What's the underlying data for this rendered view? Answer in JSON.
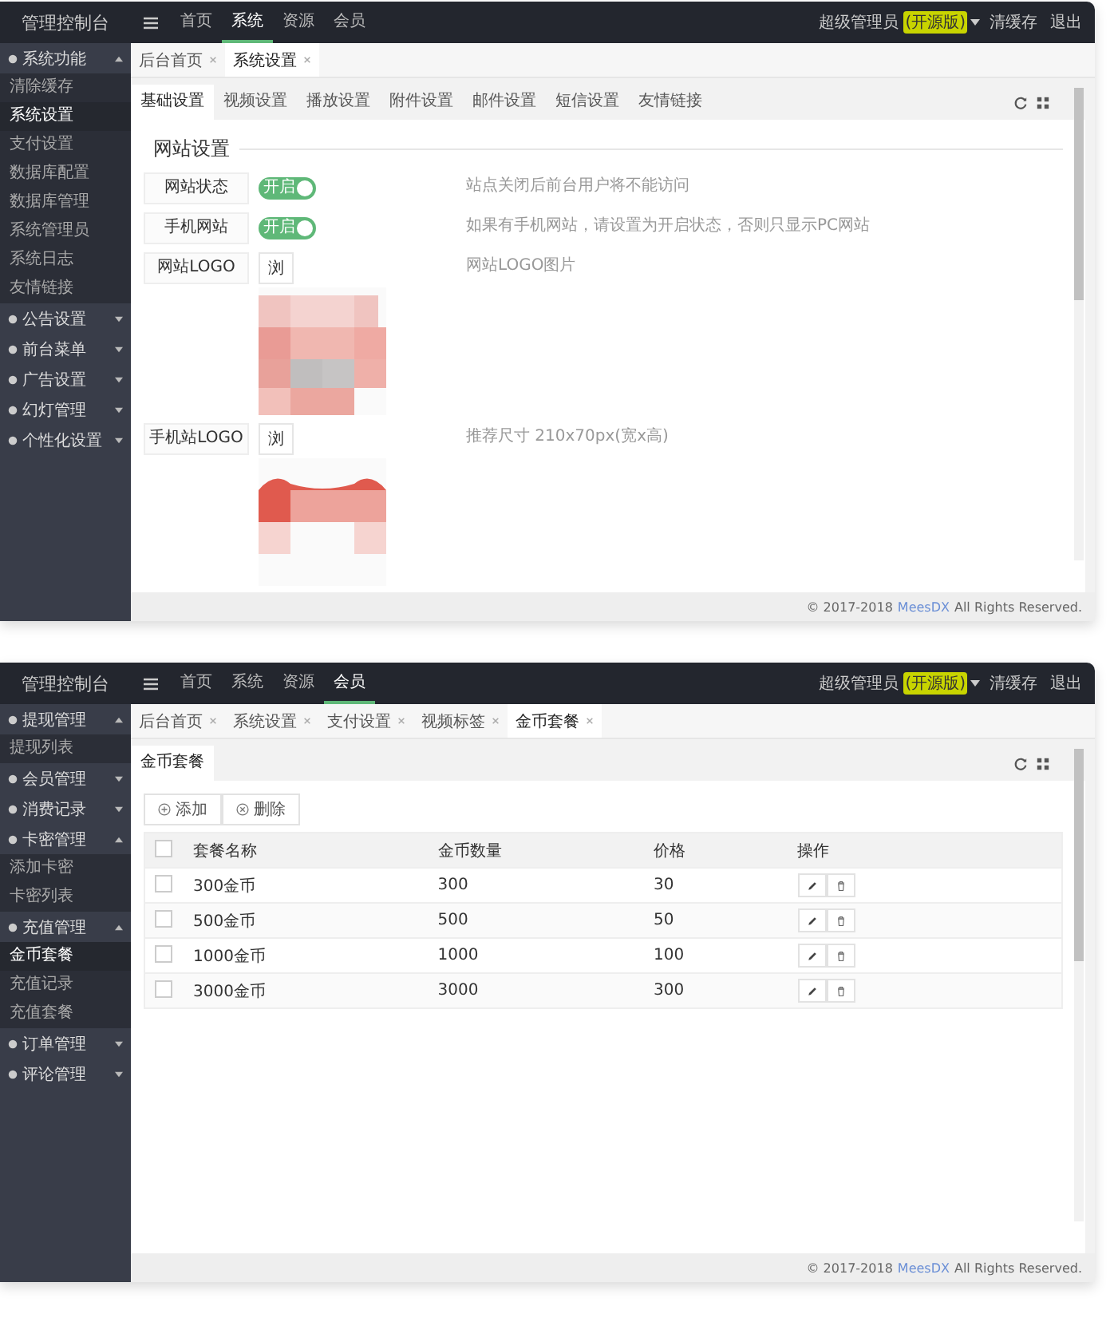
{
  "screens": [
    {
      "kind": "settings",
      "logo": "管理控制台",
      "nav": [
        {
          "label": "首页",
          "selected": false
        },
        {
          "label": "系统",
          "selected": true
        },
        {
          "label": "资源",
          "selected": false
        },
        {
          "label": "会员",
          "selected": false
        }
      ],
      "user": {
        "name": "超级管理员",
        "badge": "(开源版)",
        "links": [
          "清缓存",
          "退出"
        ]
      },
      "sidebar": [
        {
          "label": "系统功能",
          "expanded": true,
          "children": [
            {
              "label": "清除缓存",
              "selected": false
            },
            {
              "label": "系统设置",
              "selected": true
            },
            {
              "label": "支付设置",
              "selected": false
            },
            {
              "label": "数据库配置",
              "selected": false
            },
            {
              "label": "数据库管理",
              "selected": false
            },
            {
              "label": "系统管理员",
              "selected": false
            },
            {
              "label": "系统日志",
              "selected": false
            },
            {
              "label": "友情链接",
              "selected": false
            }
          ]
        },
        {
          "label": "公告设置",
          "expanded": false
        },
        {
          "label": "前台菜单",
          "expanded": false
        },
        {
          "label": "广告设置",
          "expanded": false
        },
        {
          "label": "幻灯管理",
          "expanded": false
        },
        {
          "label": "个性化设置",
          "expanded": false
        }
      ],
      "page_tabs": [
        {
          "label": "后台首页",
          "selected": false
        },
        {
          "label": "系统设置",
          "selected": true
        }
      ],
      "inner_tabs": [
        {
          "label": "基础设置",
          "selected": true
        },
        {
          "label": "视频设置",
          "selected": false
        },
        {
          "label": "播放设置",
          "selected": false
        },
        {
          "label": "附件设置",
          "selected": false
        },
        {
          "label": "邮件设置",
          "selected": false
        },
        {
          "label": "短信设置",
          "selected": false
        },
        {
          "label": "友情链接",
          "selected": false
        }
      ],
      "legend": "网站设置",
      "form": [
        {
          "kind": "toggle",
          "label": "网站状态",
          "on": true,
          "toggle_text": "开启",
          "hint": "站点关闭后前台用户将不能访问"
        },
        {
          "kind": "toggle",
          "label": "手机网站",
          "on": true,
          "toggle_text": "开启",
          "hint": "如果有手机网站，请设置为开启状态，否则只显示PC网站"
        },
        {
          "kind": "upload",
          "label": "网站LOGO",
          "button": "浏",
          "hint": "网站LOGO图片"
        },
        {
          "kind": "upload",
          "label": "手机站LOGO",
          "button": "浏",
          "hint": "推荐尺寸 210x70px(宽x高)"
        }
      ],
      "footer": {
        "text": "© 2017-2018",
        "link": "MeesDX",
        "suffix": "All Rights Reserved."
      }
    },
    {
      "kind": "table",
      "logo": "管理控制台",
      "nav": [
        {
          "label": "首页",
          "selected": false
        },
        {
          "label": "系统",
          "selected": false
        },
        {
          "label": "资源",
          "selected": false
        },
        {
          "label": "会员",
          "selected": true
        }
      ],
      "user": {
        "name": "超级管理员",
        "badge": "(开源版)",
        "links": [
          "清缓存",
          "退出"
        ]
      },
      "sidebar": [
        {
          "label": "提现管理",
          "expanded": true,
          "children": [
            {
              "label": "提现列表",
              "selected": false
            }
          ]
        },
        {
          "label": "会员管理",
          "expanded": false
        },
        {
          "label": "消费记录",
          "expanded": false
        },
        {
          "label": "卡密管理",
          "expanded": true,
          "children": [
            {
              "label": "添加卡密",
              "selected": false
            },
            {
              "label": "卡密列表",
              "selected": false
            }
          ]
        },
        {
          "label": "充值管理",
          "expanded": true,
          "children": [
            {
              "label": "金币套餐",
              "selected": true
            },
            {
              "label": "充值记录",
              "selected": false
            },
            {
              "label": "充值套餐",
              "selected": false
            }
          ]
        },
        {
          "label": "订单管理",
          "expanded": false
        },
        {
          "label": "评论管理",
          "expanded": false
        }
      ],
      "page_tabs": [
        {
          "label": "后台首页",
          "selected": false
        },
        {
          "label": "系统设置",
          "selected": false
        },
        {
          "label": "支付设置",
          "selected": false
        },
        {
          "label": "视频标签",
          "selected": false
        },
        {
          "label": "金币套餐",
          "selected": true
        }
      ],
      "inner_tabs": [
        {
          "label": "金币套餐",
          "selected": true
        }
      ],
      "toolbar": [
        {
          "kind": "add",
          "label": "添加"
        },
        {
          "kind": "delete",
          "label": "删除"
        }
      ],
      "table": {
        "select_all_checked": false,
        "columns": [
          "套餐名称",
          "金币数量",
          "价格",
          "操作"
        ],
        "rows": [
          {
            "checked": false,
            "cells": [
              "300金币",
              "300",
              "30"
            ]
          },
          {
            "checked": false,
            "cells": [
              "500金币",
              "500",
              "50"
            ]
          },
          {
            "checked": false,
            "cells": [
              "1000金币",
              "1000",
              "100"
            ]
          },
          {
            "checked": false,
            "cells": [
              "3000金币",
              "3000",
              "300"
            ]
          }
        ]
      },
      "footer": {
        "text": "© 2017-2018",
        "link": "MeesDX",
        "suffix": "All Rights Reserved."
      }
    }
  ]
}
